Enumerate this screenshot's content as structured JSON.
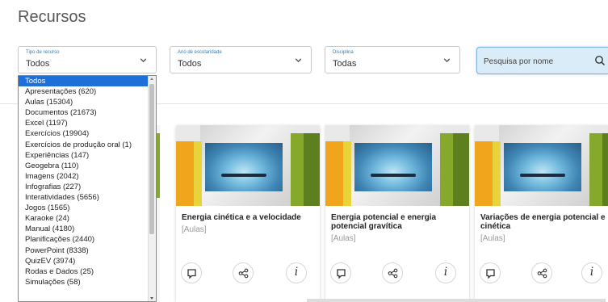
{
  "page": {
    "title": "Recursos"
  },
  "filters": {
    "tipo": {
      "label": "Tipo de recurso",
      "value": "Todos"
    },
    "ano": {
      "label": "Ano de escolaridade",
      "value": "Todos"
    },
    "disciplina": {
      "label": "Disciplina",
      "value": "Todas"
    }
  },
  "search": {
    "placeholder": "Pesquisa por nome"
  },
  "dropdown": {
    "items": [
      "Todos",
      "Apresentações (620)",
      "Aulas (15304)",
      "Documentos (21673)",
      "Excel (1197)",
      "Exercícios (19904)",
      "Exercícios de produção oral (1)",
      "Experiências (147)",
      "Geogebra (110)",
      "Imagens (2042)",
      "Infografias (227)",
      "Interatividades (5656)",
      "Jogos (1565)",
      "Karaoke (24)",
      "Manual (4180)",
      "Planificações (2440)",
      "PowerPoint (8338)",
      "QuizEV (3974)",
      "Rodas e Dados (25)",
      "Simulações (58)"
    ]
  },
  "cards": [
    {
      "title": "Energia cinética e a velocidade",
      "type": "[Aulas]",
      "info": "i"
    },
    {
      "title": "Energia potencial e energia potencial gravítica",
      "type": "[Aulas]",
      "info": "i"
    },
    {
      "title": "Variações de energia potencial e cinética",
      "type": "[Aulas]",
      "info": "i"
    }
  ],
  "colors": {
    "accent_blue": "#2a7fc0",
    "selected_item": "#1e6fd9",
    "search_bg": "#d9ecf8",
    "strip_orange": "#f1a51d",
    "strip_green": "#87a92b"
  },
  "icons": {
    "filter_chevron": "chevron-down-icon",
    "search": "search-icon",
    "save": "bookmark-icon",
    "share": "share-icon",
    "info": "info-icon"
  }
}
